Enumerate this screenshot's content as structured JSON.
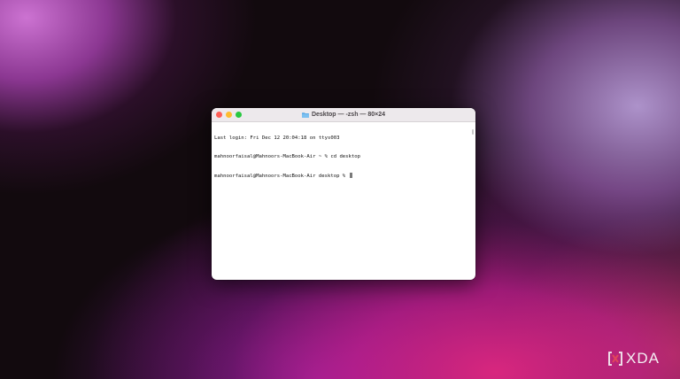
{
  "window": {
    "title": "Desktop — -zsh — 80×24",
    "title_icon": "folder-icon"
  },
  "terminal": {
    "lines": [
      "Last login: Fri Dec 12 20:04:18 on ttys003",
      "mahnoorfaisal@Mahnoors-MacBook-Air ~ % cd desktop",
      "mahnoorfaisal@Mahnoors-MacBook-Air desktop % "
    ]
  },
  "watermark": {
    "text": "XDA",
    "logo": "xda-logo-icon"
  },
  "colors": {
    "close": "#fe5f57",
    "minimize": "#febc2e",
    "maximize": "#28c840",
    "titlebar": "#ede9ec"
  }
}
